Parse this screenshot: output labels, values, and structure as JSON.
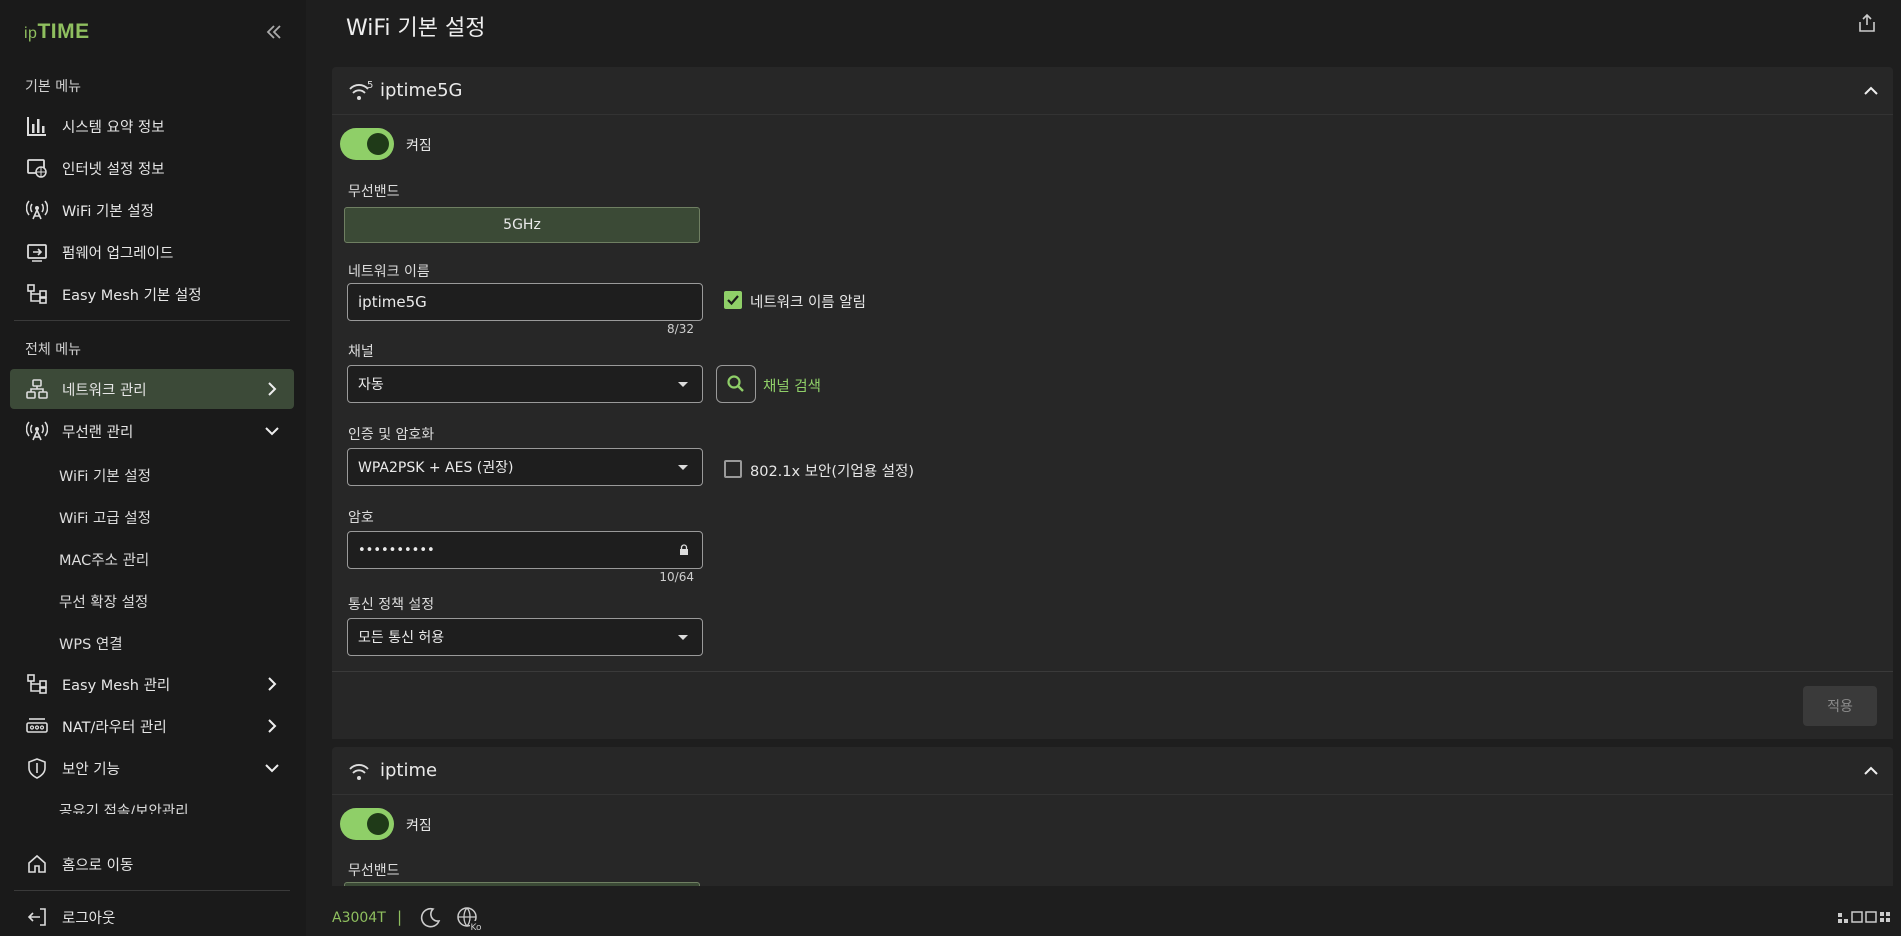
{
  "brand": {
    "logo_prefix": "ip",
    "logo_main": "TIME"
  },
  "sidebar": {
    "basic_menu_title": "기본 메뉴",
    "basic_items": [
      {
        "label": "시스템 요약 정보",
        "icon": "bar-chart-icon"
      },
      {
        "label": "인터넷 설정 정보",
        "icon": "internet-icon"
      },
      {
        "label": "WiFi 기본 설정",
        "icon": "antenna-icon"
      },
      {
        "label": "펌웨어 업그레이드",
        "icon": "firmware-icon"
      },
      {
        "label": "Easy Mesh 기본 설정",
        "icon": "mesh-icon"
      }
    ],
    "all_menu_title": "전체 메뉴",
    "all_items": {
      "network": "네트워크 관리",
      "wlan": "무선랜 관리",
      "wlan_sub": [
        "WiFi 기본 설정",
        "WiFi 고급 설정",
        "MAC주소 관리",
        "무선 확장 설정",
        "WPS 연결"
      ],
      "easymesh": "Easy Mesh 관리",
      "nat": "NAT/라우터 관리",
      "security": "보안 기능",
      "security_sub": [
        "공유기 접속/보안관리"
      ]
    },
    "home": "홈으로 이동",
    "logout": "로그아웃"
  },
  "main": {
    "title": "WiFi 기본 설정",
    "card1": {
      "ssid_title": "iptime5G",
      "band_badge": "5",
      "toggle_label": "켜짐",
      "band_label": "무선밴드",
      "band_value": "5GHz",
      "network_name_label": "네트워크 이름",
      "network_name_value": "iptime5G",
      "network_name_counter": "8/32",
      "broadcast_label": "네트워크 이름 알림",
      "channel_label": "채널",
      "channel_value": "자동",
      "channel_search": "채널 검색",
      "auth_label": "인증 및 암호화",
      "auth_value": "WPA2PSK + AES (권장)",
      "enterprise_label": "802.1x 보안(기업용 설정)",
      "password_label": "암호",
      "password_value": "••••••••••",
      "password_counter": "10/64",
      "policy_label": "통신 정책 설정",
      "policy_value": "모든 통신 허용",
      "apply": "적용"
    },
    "card2": {
      "ssid_title": "iptime",
      "toggle_label": "켜짐",
      "band_label": "무선밴드"
    }
  },
  "status": {
    "model": "A3004T",
    "separator": "|",
    "lang": "Ko"
  },
  "colors": {
    "accent": "#8fcf68",
    "bg": "#1e1e1e",
    "card": "#272727",
    "active": "#3c4a38"
  }
}
